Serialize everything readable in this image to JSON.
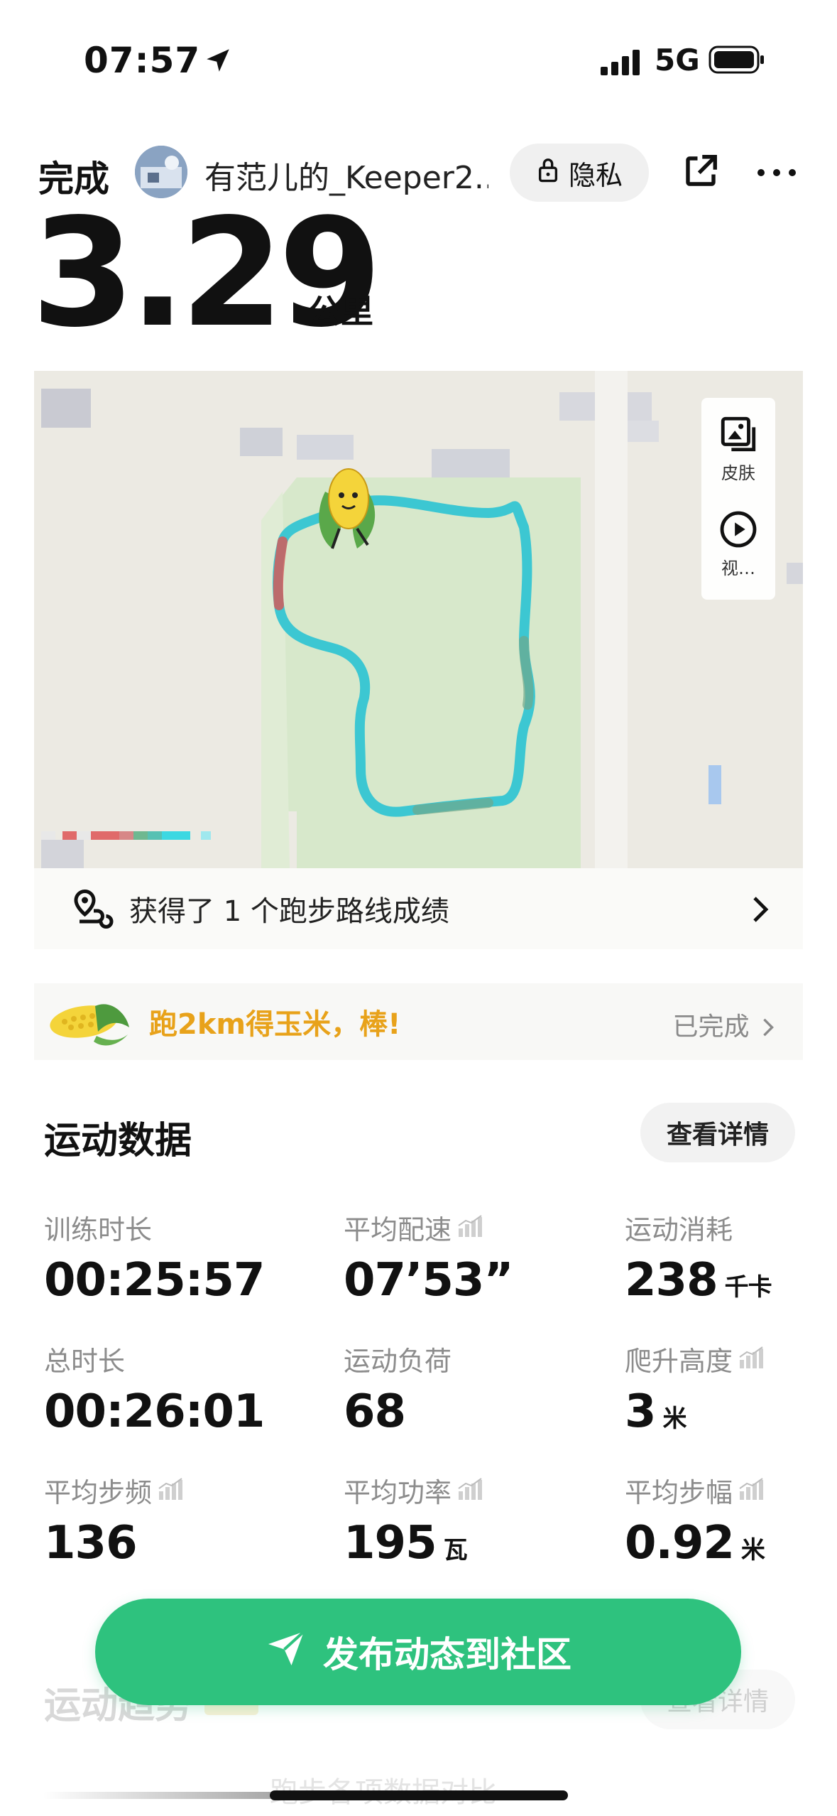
{
  "status_bar": {
    "time": "07:57",
    "network": "5G"
  },
  "header": {
    "status": "完成",
    "username": "有范儿的_Keeper2...",
    "privacy_label": "隐私",
    "distance": "3.29",
    "distance_unit": "公里"
  },
  "map": {
    "tools": [
      {
        "label": "皮肤",
        "icon": "image-skin-icon"
      },
      {
        "label": "视…",
        "icon": "play-video-icon"
      }
    ],
    "achievement_text": "获得了 1 个跑步路线成绩"
  },
  "banner": {
    "text": "跑2km得玉米，棒!",
    "status": "已完成"
  },
  "sports_data": {
    "title": "运动数据",
    "detail_label": "查看详情",
    "stats": [
      {
        "label": "训练时长",
        "value": "00:25:57",
        "unit": "",
        "chart_icon": false
      },
      {
        "label": "平均配速",
        "value": "07’53”",
        "unit": "",
        "chart_icon": true
      },
      {
        "label": "运动消耗",
        "value": "238",
        "unit": "千卡",
        "chart_icon": false
      },
      {
        "label": "总时长",
        "value": "00:26:01",
        "unit": "",
        "chart_icon": false
      },
      {
        "label": "运动负荷",
        "value": "68",
        "unit": "",
        "chart_icon": false
      },
      {
        "label": "爬升高度",
        "value": "3",
        "unit": "米",
        "chart_icon": true
      },
      {
        "label": "平均步频",
        "value": "136",
        "unit": "",
        "chart_icon": true
      },
      {
        "label": "平均功率",
        "value": "195",
        "unit": "瓦",
        "chart_icon": true
      },
      {
        "label": "平均步幅",
        "value": "0.92",
        "unit": "米",
        "chart_icon": true
      }
    ]
  },
  "trend": {
    "title": "运动趋势",
    "detail_label": "查看详情",
    "cut_text": "跑步各项数据对比"
  },
  "publish_label": "发布动态到社区",
  "colors": {
    "accent": "#2ec27e",
    "banner_text": "#e8a21a",
    "route": "#3cc7d2",
    "park": "#d7e8cb"
  }
}
